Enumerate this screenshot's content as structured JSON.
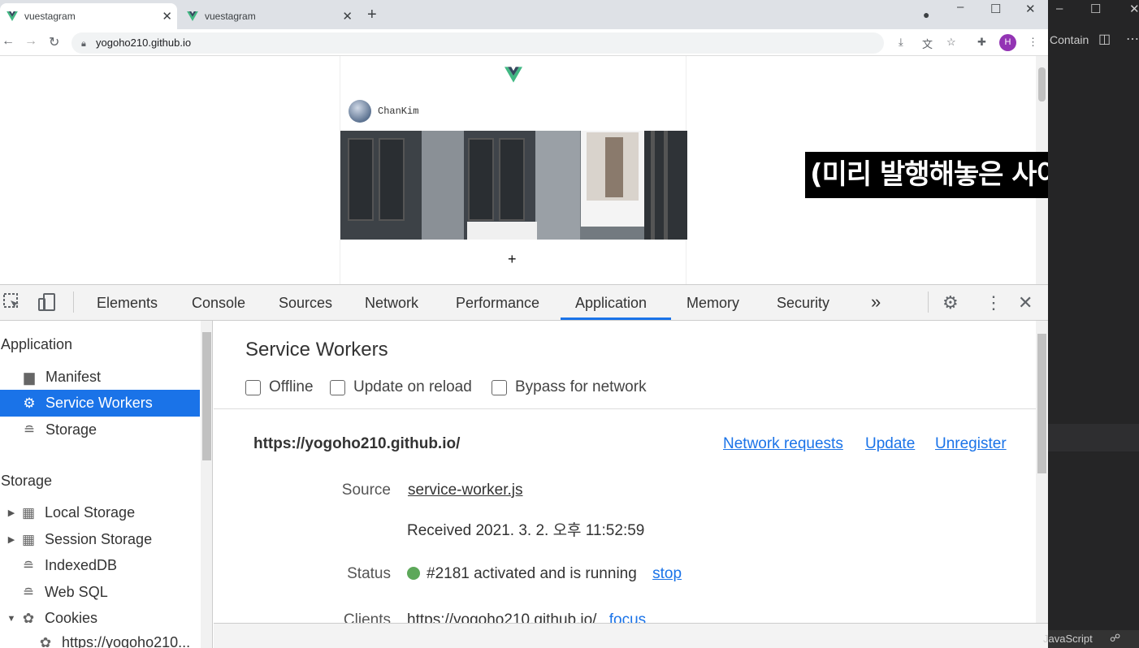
{
  "browser": {
    "tabs": [
      {
        "title": "vuestagram",
        "active": true
      },
      {
        "title": "vuestagram",
        "active": false
      }
    ],
    "address": "yogoho210.github.io",
    "profile_initial": "H"
  },
  "page": {
    "username": "ChanKim",
    "plus_label": "+",
    "subtitle": "(미리 발행해놓은 사이트임)"
  },
  "devtools": {
    "tabs": [
      "Elements",
      "Console",
      "Sources",
      "Network",
      "Performance",
      "Application",
      "Memory",
      "Security"
    ],
    "active_tab": "Application",
    "more_label": "»",
    "sidebar": {
      "application_header": "Application",
      "application_items": [
        {
          "label": "Manifest",
          "icon": "document-icon"
        },
        {
          "label": "Service Workers",
          "icon": "gear-icon",
          "selected": true
        },
        {
          "label": "Storage",
          "icon": "database-icon"
        }
      ],
      "storage_header": "Storage",
      "storage_items": [
        {
          "label": "Local Storage",
          "icon": "grid-icon",
          "expander": "collapsed"
        },
        {
          "label": "Session Storage",
          "icon": "grid-icon",
          "expander": "collapsed"
        },
        {
          "label": "IndexedDB",
          "icon": "database-icon"
        },
        {
          "label": "Web SQL",
          "icon": "database-icon"
        },
        {
          "label": "Cookies",
          "icon": "cookie-icon",
          "expander": "expanded"
        },
        {
          "label": "https://yogoho210...",
          "icon": "cookie-icon"
        }
      ]
    },
    "service_workers": {
      "title": "Service Workers",
      "options": [
        "Offline",
        "Update on reload",
        "Bypass for network"
      ],
      "origin": "https://yogoho210.github.io/",
      "actions": [
        "Network requests",
        "Update",
        "Unregister"
      ],
      "source_label": "Source",
      "source_file": "service-worker.js",
      "received": "Received 2021. 3. 2. 오후 11:52:59",
      "status_label": "Status",
      "status_text": "#2181 activated and is running",
      "status_action": "stop",
      "clients_label": "Clients",
      "clients_value": "https://yogoho210.github.io/",
      "clients_action": "focus"
    }
  },
  "editor": {
    "contain_label": "Contain",
    "language": "JavaScript"
  },
  "colors": {
    "accent": "#1a73e8",
    "status_running": "#5da85a",
    "profile": "#9334b4"
  }
}
